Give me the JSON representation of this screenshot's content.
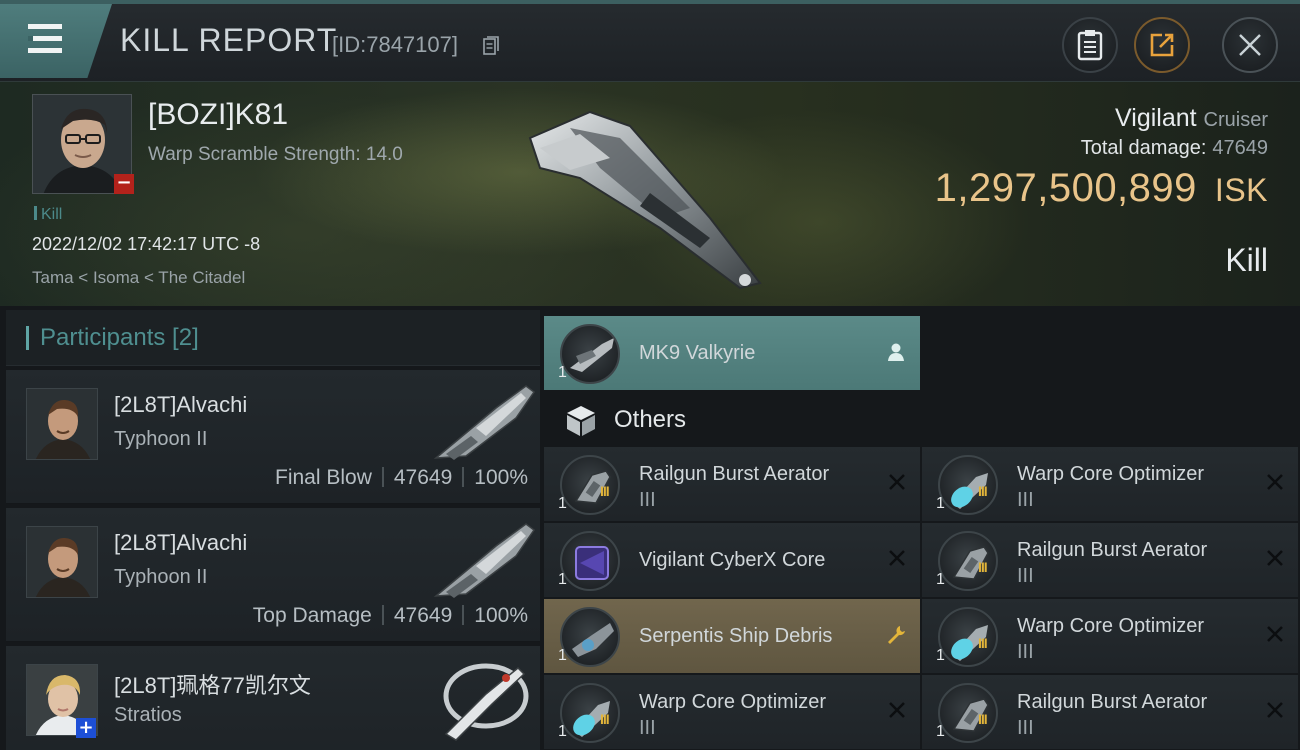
{
  "header": {
    "title": "KILL REPORT",
    "report_id": "[ID:7847107]"
  },
  "victim": {
    "name": "[BOZI]K81",
    "warp_scramble": "Warp Scramble Strength: 14.0",
    "tag": "Kill",
    "datetime": "2022/12/02 17:42:17 UTC -8",
    "location": "Tama < Isoma < The Citadel",
    "ship_name": "Vigilant",
    "ship_class": "Cruiser",
    "total_damage_label": "Total damage:",
    "total_damage": "47649",
    "isk_value": "1,297,500,899",
    "isk_unit": "ISK",
    "result": "Kill"
  },
  "participants": {
    "title": "Participants [2]",
    "items": [
      {
        "name": "[2L8T]Alvachi",
        "ship": "Typhoon II",
        "role": "Final Blow",
        "damage": "47649",
        "percent": "100%"
      },
      {
        "name": "[2L8T]Alvachi",
        "ship": "Typhoon II",
        "role": "Top Damage",
        "damage": "47649",
        "percent": "100%"
      },
      {
        "name": "[2L8T]珮格77凯尔文",
        "ship": "Stratios"
      }
    ]
  },
  "fit": {
    "drone": {
      "name": "MK9  Valkyrie",
      "qty": "1"
    },
    "others_title": "Others",
    "left_items": [
      {
        "name": "Railgun Burst Aerator",
        "sub": "III",
        "qty": "1",
        "meta": "III"
      },
      {
        "name": "Vigilant CyberX Core",
        "sub": "",
        "qty": "1",
        "meta": ""
      },
      {
        "name": "Serpentis Ship Debris",
        "sub": "",
        "qty": "1",
        "meta": ""
      },
      {
        "name": "Warp Core Optimizer",
        "sub": "III",
        "qty": "1",
        "meta": "III"
      }
    ],
    "right_items": [
      {
        "name": "Warp Core Optimizer",
        "sub": "III",
        "qty": "1",
        "meta": "III"
      },
      {
        "name": "Railgun Burst Aerator",
        "sub": "III",
        "qty": "1",
        "meta": "III"
      },
      {
        "name": "Warp Core Optimizer",
        "sub": "III",
        "qty": "1",
        "meta": "III"
      },
      {
        "name": "Railgun Burst Aerator",
        "sub": "III",
        "qty": "1",
        "meta": "III"
      }
    ]
  },
  "colors": {
    "accent_teal": "#4f8f90",
    "isk_gold": "#e9c48a",
    "highlight_teal": "#5b8a88",
    "highlight_gold": "#71664d"
  }
}
